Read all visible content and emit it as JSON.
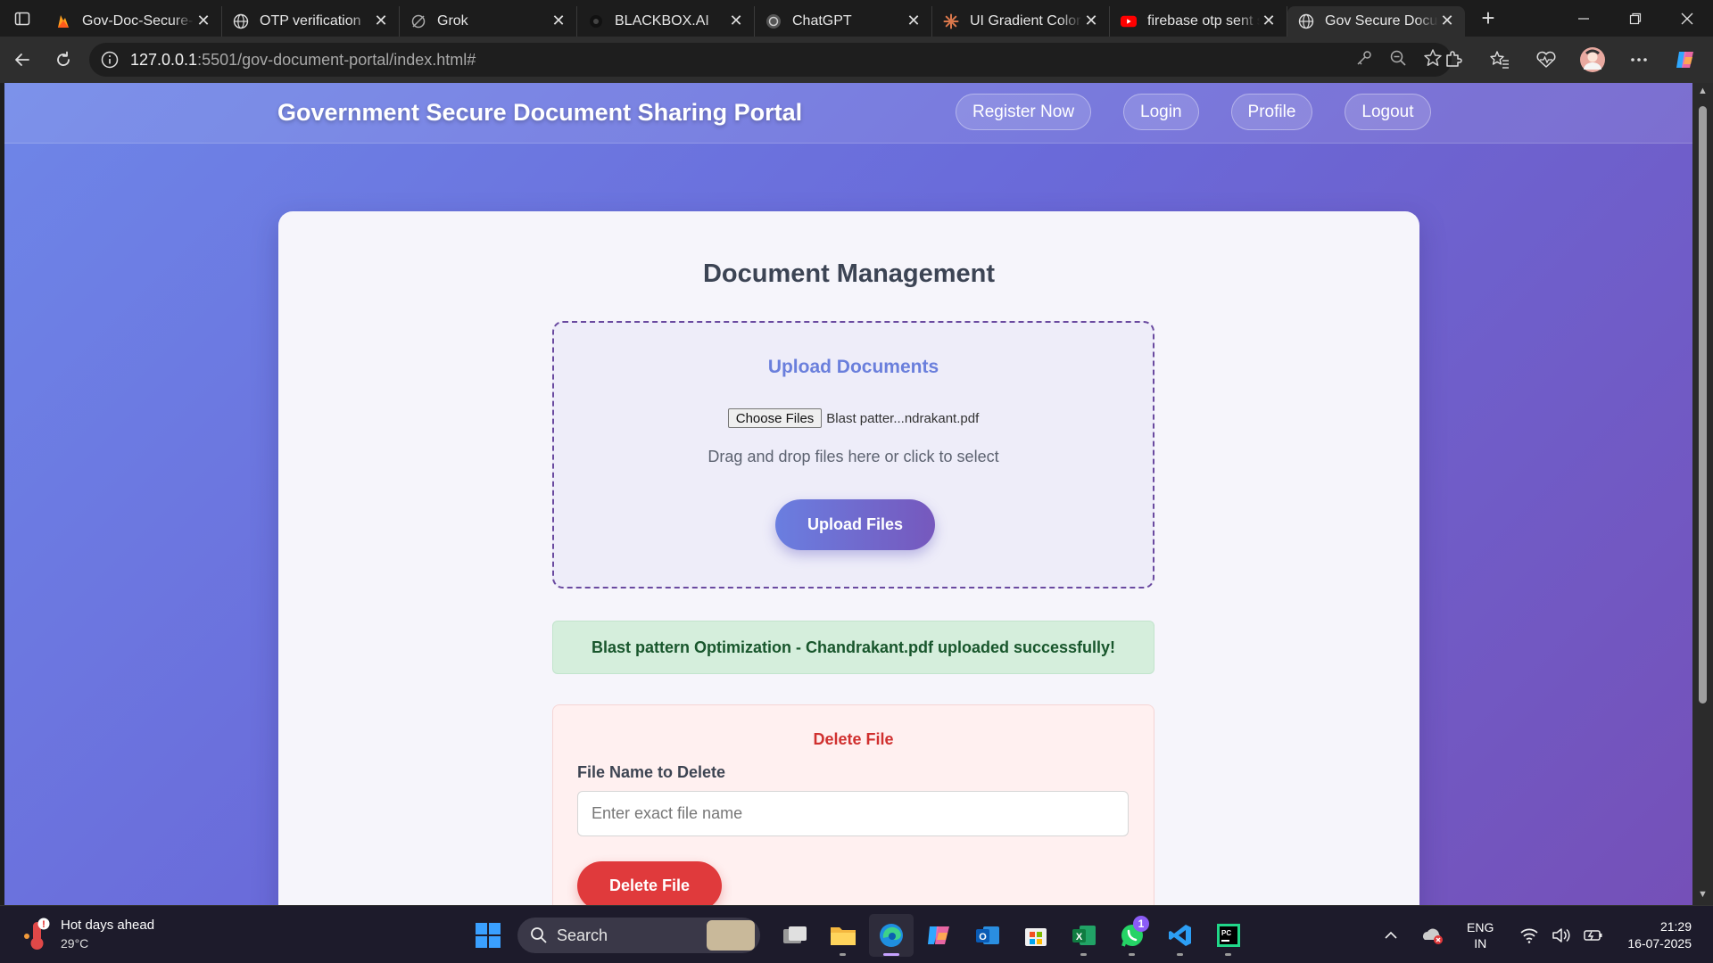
{
  "browser": {
    "tabs": [
      {
        "title": "Gov-Doc-Secure-Sharing",
        "icon": "firebase-icon"
      },
      {
        "title": "OTP verification",
        "icon": "globe-icon"
      },
      {
        "title": "Grok",
        "icon": "grok-icon"
      },
      {
        "title": "BLACKBOX.AI",
        "icon": "blackbox-icon"
      },
      {
        "title": "ChatGPT",
        "icon": "chatgpt-icon"
      },
      {
        "title": "UI Gradient Color Palette",
        "icon": "claude-icon"
      },
      {
        "title": "firebase otp sent success",
        "icon": "youtube-icon"
      },
      {
        "title": "Gov Secure Document Portal",
        "icon": "globe-icon",
        "active": true
      }
    ],
    "address": {
      "host": "127.0.0.1",
      "path": ":5501/gov-document-portal/index.html#"
    }
  },
  "site": {
    "title": "Government Secure Document Sharing Portal",
    "nav": [
      "Register Now",
      "Login",
      "Profile",
      "Logout"
    ]
  },
  "main": {
    "title": "Document Management",
    "upload": {
      "title": "Upload Documents",
      "choose_label": "Choose Files",
      "selected_file": "Blast patter...ndrakant.pdf",
      "hint": "Drag and drop files here or click to select",
      "button": "Upload Files"
    },
    "status": "Blast pattern Optimization - Chandrakant.pdf uploaded successfully!",
    "delete": {
      "title": "Delete File",
      "label": "File Name to Delete",
      "placeholder": "Enter exact file name",
      "button": "Delete File"
    }
  },
  "taskbar": {
    "weather": {
      "headline": "Hot days ahead",
      "temp": "29°C",
      "alert": "!"
    },
    "search": "Search",
    "whatsapp_badge": "1",
    "lang": {
      "line1": "ENG",
      "line2": "IN"
    },
    "clock": {
      "time": "21:29",
      "date": "16-07-2025"
    }
  },
  "colors": {
    "gradient_start": "#6e86e8",
    "gradient_end": "#7550b8",
    "upload_accent": "#6a7fdc",
    "success_bg": "#d5eedc",
    "danger": "#e03a3c"
  }
}
